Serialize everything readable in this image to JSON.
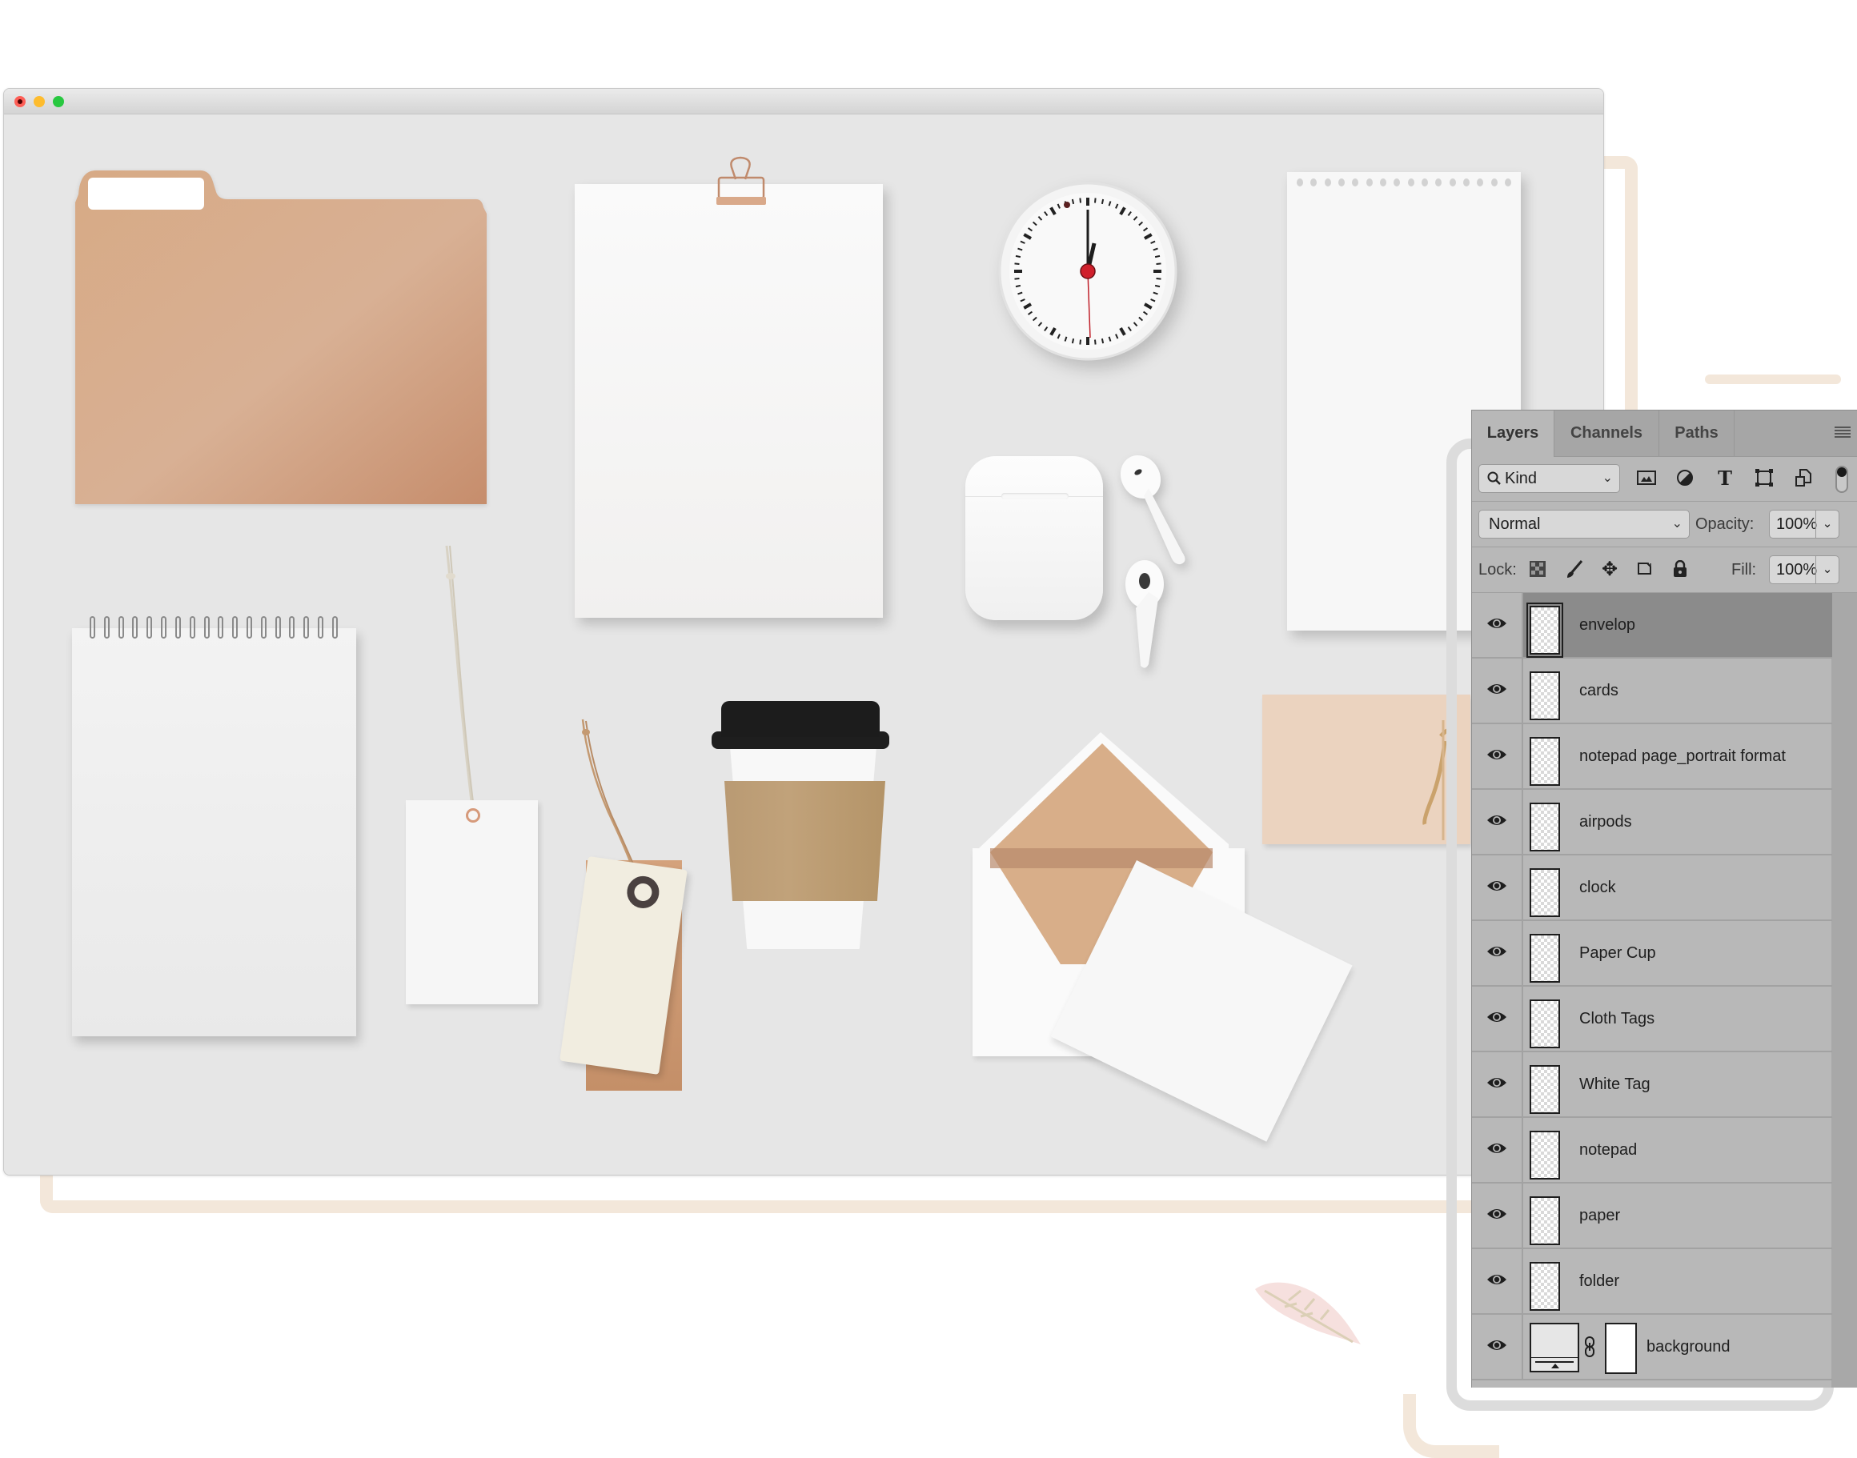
{
  "window": {
    "traffic_lights": {
      "close": "#fe5f57",
      "minimize": "#febc2e",
      "maximize": "#28c840"
    }
  },
  "canvas": {
    "background_color": "#e6e6e6",
    "objects": [
      "folder",
      "paper",
      "clock",
      "notepad page_portrait format",
      "notepad",
      "White Tag",
      "Cloth Tags",
      "Paper Cup",
      "airpods",
      "envelop",
      "cards"
    ]
  },
  "panel": {
    "tabs": [
      {
        "label": "Layers",
        "active": true
      },
      {
        "label": "Channels",
        "active": false
      },
      {
        "label": "Paths",
        "active": false
      }
    ],
    "menu_icon": "panel-menu-icon",
    "filter": {
      "kind_label": "Kind",
      "icons": [
        "image-filter-icon",
        "adjustment-filter-icon",
        "type-filter-icon",
        "shape-filter-icon",
        "smart-object-filter-icon",
        "filter-toggle-icon"
      ]
    },
    "blend_mode": "Normal",
    "opacity_label": "Opacity:",
    "opacity_value": "100%",
    "lock_label": "Lock:",
    "lock_icons": [
      "lock-transparent-pixels-icon",
      "lock-image-pixels-icon",
      "lock-position-icon",
      "lock-artboard-icon",
      "lock-all-icon"
    ],
    "fill_label": "Fill:",
    "fill_value": "100%",
    "layers": [
      {
        "name": "envelop",
        "visible": true,
        "selected": true
      },
      {
        "name": "cards",
        "visible": true,
        "selected": false
      },
      {
        "name": "notepad page_portrait format",
        "visible": true,
        "selected": false
      },
      {
        "name": "airpods",
        "visible": true,
        "selected": false
      },
      {
        "name": "clock",
        "visible": true,
        "selected": false
      },
      {
        "name": "Paper Cup",
        "visible": true,
        "selected": false
      },
      {
        "name": "Cloth Tags",
        "visible": true,
        "selected": false
      },
      {
        "name": "White Tag",
        "visible": true,
        "selected": false
      },
      {
        "name": "notepad",
        "visible": true,
        "selected": false
      },
      {
        "name": "paper",
        "visible": true,
        "selected": false
      },
      {
        "name": "folder",
        "visible": true,
        "selected": false
      },
      {
        "name": "background",
        "visible": true,
        "selected": false
      }
    ]
  },
  "colors": {
    "accent_beige": "#f3e7da",
    "folder": "#d4a784",
    "panel_bg": "#b8b8b8",
    "selected_layer": "#8b8b8b"
  }
}
